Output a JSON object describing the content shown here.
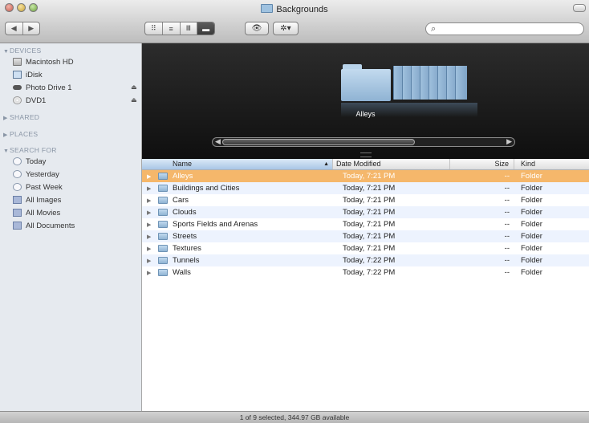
{
  "window": {
    "title": "Backgrounds"
  },
  "toolbar": {
    "back_glyph": "◀",
    "forward_glyph": "▶",
    "view_icons": [
      "icon-view-icon",
      "list-view-icon",
      "column-view-icon",
      "coverflow-view-icon"
    ],
    "view_glyphs": [
      "⠿",
      "≡",
      "Ⅲ",
      "▬"
    ],
    "quicklook_glyph": "👁",
    "action_glyph": "✲▾",
    "search_placeholder": ""
  },
  "sidebar": {
    "devices_header": "DEVICES",
    "devices": [
      {
        "label": "Macintosh HD",
        "icon": "hard-drive-icon",
        "eject": false
      },
      {
        "label": "iDisk",
        "icon": "idisk-icon",
        "eject": false
      },
      {
        "label": "Photo Drive 1",
        "icon": "external-drive-icon",
        "eject": true
      },
      {
        "label": "DVD1",
        "icon": "dvd-icon",
        "eject": true
      }
    ],
    "shared_header": "SHARED",
    "places_header": "PLACES",
    "search_header": "SEARCH FOR",
    "searches": [
      {
        "label": "Today",
        "icon": "clock-icon"
      },
      {
        "label": "Yesterday",
        "icon": "clock-icon"
      },
      {
        "label": "Past Week",
        "icon": "clock-icon"
      },
      {
        "label": "All Images",
        "icon": "smart-folder-icon"
      },
      {
        "label": "All Movies",
        "icon": "smart-folder-icon"
      },
      {
        "label": "All Documents",
        "icon": "smart-folder-icon"
      }
    ],
    "eject_glyph": "⏏"
  },
  "coverflow": {
    "selected_label": "Alleys"
  },
  "list": {
    "columns": {
      "name": "Name",
      "date": "Date Modified",
      "size": "Size",
      "kind": "Kind"
    },
    "sort_glyph": "▲",
    "rows": [
      {
        "name": "Alleys",
        "date": "Today, 7:21 PM",
        "size": "--",
        "kind": "Folder",
        "selected": true
      },
      {
        "name": "Buildings and Cities",
        "date": "Today, 7:21 PM",
        "size": "--",
        "kind": "Folder"
      },
      {
        "name": "Cars",
        "date": "Today, 7:21 PM",
        "size": "--",
        "kind": "Folder"
      },
      {
        "name": "Clouds",
        "date": "Today, 7:21 PM",
        "size": "--",
        "kind": "Folder"
      },
      {
        "name": "Sports Fields and Arenas",
        "date": "Today, 7:21 PM",
        "size": "--",
        "kind": "Folder"
      },
      {
        "name": "Streets",
        "date": "Today, 7:21 PM",
        "size": "--",
        "kind": "Folder"
      },
      {
        "name": "Textures",
        "date": "Today, 7:21 PM",
        "size": "--",
        "kind": "Folder"
      },
      {
        "name": "Tunnels",
        "date": "Today, 7:22 PM",
        "size": "--",
        "kind": "Folder"
      },
      {
        "name": "Walls",
        "date": "Today, 7:22 PM",
        "size": "--",
        "kind": "Folder"
      }
    ]
  },
  "statusbar": {
    "text": "1 of 9 selected, 344.97 GB available"
  }
}
